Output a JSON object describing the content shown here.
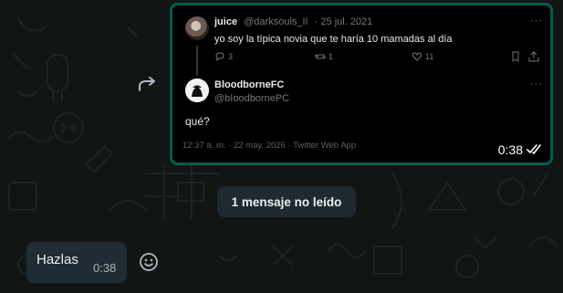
{
  "tweet": {
    "author_name": "juice",
    "author_handle": "@darksouls_II",
    "date": "· 25 jul. 2021",
    "text": "yo soy la típica novia que te haría 10 mamadas al día",
    "more": "···",
    "replies": "3",
    "retweets": "1",
    "likes": "11"
  },
  "reply": {
    "name": "BloodborneFC",
    "handle": "@bIoodbornePC",
    "more": "···",
    "text": "qué?",
    "meta": "12:37 a. m. · 22 may. 2026 · Twitter Web App"
  },
  "outgoing": {
    "time": "0:38"
  },
  "unread_divider": {
    "label": "1 mensaje no leído"
  },
  "incoming": {
    "text": "Hazlas",
    "time": "0:38"
  },
  "colors": {
    "background": "#111514",
    "outgoing_bubble": "#005c4b",
    "incoming_bubble": "#202c33",
    "divider_pill": "#1f2a30"
  }
}
